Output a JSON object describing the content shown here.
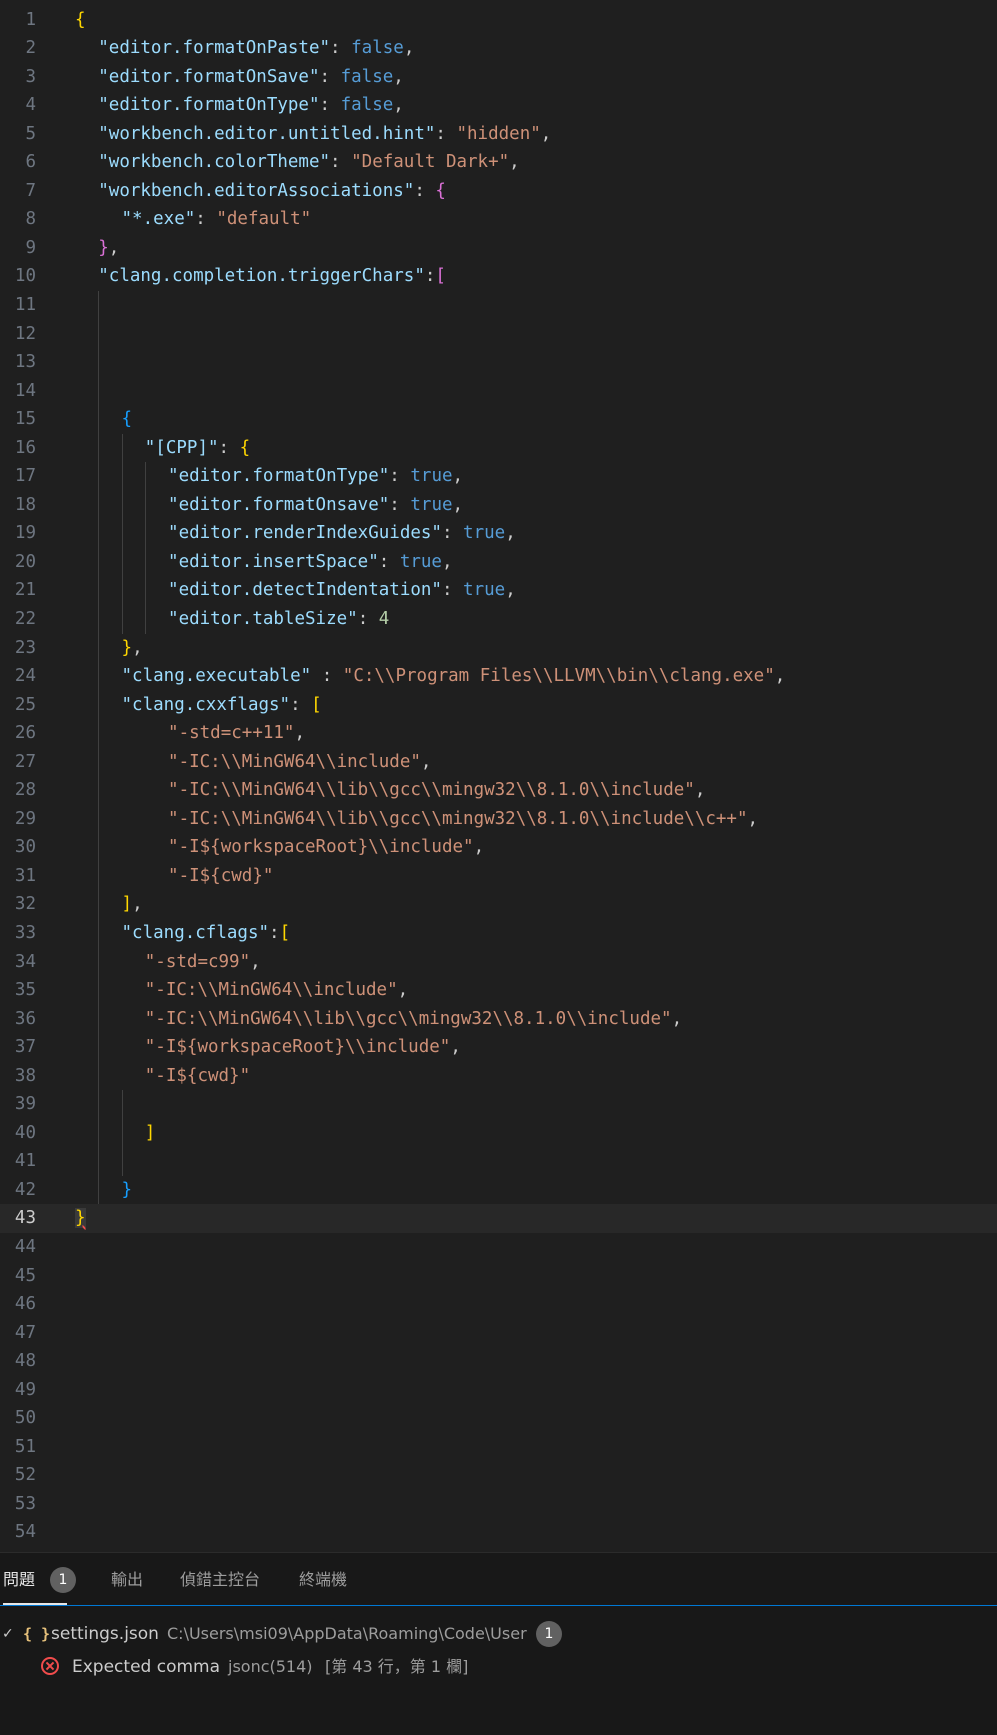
{
  "editor": {
    "current_line": 43,
    "lines": [
      {
        "n": "1",
        "indent": 0,
        "tokens": [
          {
            "t": "{",
            "c": "br1"
          }
        ]
      },
      {
        "n": "2",
        "indent": 1,
        "tokens": [
          {
            "t": "\"editor.formatOnPaste\"",
            "c": "tok-key"
          },
          {
            "t": ": ",
            "c": "tok-punc"
          },
          {
            "t": "false",
            "c": "tok-kw"
          },
          {
            "t": ",",
            "c": "tok-punc"
          }
        ]
      },
      {
        "n": "3",
        "indent": 1,
        "tokens": [
          {
            "t": "\"editor.formatOnSave\"",
            "c": "tok-key"
          },
          {
            "t": ": ",
            "c": "tok-punc"
          },
          {
            "t": "false",
            "c": "tok-kw"
          },
          {
            "t": ",",
            "c": "tok-punc"
          }
        ]
      },
      {
        "n": "4",
        "indent": 1,
        "tokens": [
          {
            "t": "\"editor.formatOnType\"",
            "c": "tok-key"
          },
          {
            "t": ": ",
            "c": "tok-punc"
          },
          {
            "t": "false",
            "c": "tok-kw"
          },
          {
            "t": ",",
            "c": "tok-punc"
          }
        ]
      },
      {
        "n": "5",
        "indent": 1,
        "tokens": [
          {
            "t": "\"workbench.editor.untitled.hint\"",
            "c": "tok-key"
          },
          {
            "t": ": ",
            "c": "tok-punc"
          },
          {
            "t": "\"hidden\"",
            "c": "tok-str"
          },
          {
            "t": ",",
            "c": "tok-punc"
          }
        ]
      },
      {
        "n": "6",
        "indent": 1,
        "tokens": [
          {
            "t": "\"workbench.colorTheme\"",
            "c": "tok-key"
          },
          {
            "t": ": ",
            "c": "tok-punc"
          },
          {
            "t": "\"Default Dark+\"",
            "c": "tok-str"
          },
          {
            "t": ",",
            "c": "tok-punc"
          }
        ]
      },
      {
        "n": "7",
        "indent": 1,
        "tokens": [
          {
            "t": "\"workbench.editorAssociations\"",
            "c": "tok-key"
          },
          {
            "t": ": ",
            "c": "tok-punc"
          },
          {
            "t": "{",
            "c": "br2"
          }
        ]
      },
      {
        "n": "8",
        "indent": 2,
        "tokens": [
          {
            "t": "\"*.exe\"",
            "c": "tok-key"
          },
          {
            "t": ": ",
            "c": "tok-punc"
          },
          {
            "t": "\"default\"",
            "c": "tok-str"
          }
        ]
      },
      {
        "n": "9",
        "indent": 1,
        "tokens": [
          {
            "t": "}",
            "c": "br2"
          },
          {
            "t": ",",
            "c": "tok-punc"
          }
        ]
      },
      {
        "n": "10",
        "indent": 1,
        "tokens": [
          {
            "t": "\"clang.completion.triggerChars\"",
            "c": "tok-key"
          },
          {
            "t": ":",
            "c": "tok-punc"
          },
          {
            "t": "[",
            "c": "br2"
          }
        ]
      },
      {
        "n": "11",
        "indent": 0,
        "guides": [
          1
        ],
        "tokens": []
      },
      {
        "n": "12",
        "indent": 0,
        "guides": [
          1
        ],
        "tokens": []
      },
      {
        "n": "13",
        "indent": 0,
        "guides": [
          1
        ],
        "tokens": []
      },
      {
        "n": "14",
        "indent": 0,
        "guides": [
          1
        ],
        "tokens": []
      },
      {
        "n": "15",
        "indent": 2,
        "guides": [
          1
        ],
        "tokens": [
          {
            "t": "{",
            "c": "br3"
          }
        ]
      },
      {
        "n": "16",
        "indent": 3,
        "guides": [
          1,
          2
        ],
        "tokens": [
          {
            "t": "\"[CPP]\"",
            "c": "tok-key"
          },
          {
            "t": ": ",
            "c": "tok-punc"
          },
          {
            "t": "{",
            "c": "br1"
          }
        ]
      },
      {
        "n": "17",
        "indent": 4,
        "guides": [
          1,
          2,
          3
        ],
        "tokens": [
          {
            "t": "\"editor.formatOnType\"",
            "c": "tok-key"
          },
          {
            "t": ": ",
            "c": "tok-punc"
          },
          {
            "t": "true",
            "c": "tok-kw"
          },
          {
            "t": ",",
            "c": "tok-punc"
          }
        ]
      },
      {
        "n": "18",
        "indent": 4,
        "guides": [
          1,
          2,
          3
        ],
        "tokens": [
          {
            "t": "\"editor.formatOnsave\"",
            "c": "tok-key"
          },
          {
            "t": ": ",
            "c": "tok-punc"
          },
          {
            "t": "true",
            "c": "tok-kw"
          },
          {
            "t": ",",
            "c": "tok-punc"
          }
        ]
      },
      {
        "n": "19",
        "indent": 4,
        "guides": [
          1,
          2,
          3
        ],
        "tokens": [
          {
            "t": "\"editor.renderIndexGuides\"",
            "c": "tok-key"
          },
          {
            "t": ": ",
            "c": "tok-punc"
          },
          {
            "t": "true",
            "c": "tok-kw"
          },
          {
            "t": ",",
            "c": "tok-punc"
          }
        ]
      },
      {
        "n": "20",
        "indent": 4,
        "guides": [
          1,
          2,
          3
        ],
        "tokens": [
          {
            "t": "\"editor.insertSpace\"",
            "c": "tok-key"
          },
          {
            "t": ": ",
            "c": "tok-punc"
          },
          {
            "t": "true",
            "c": "tok-kw"
          },
          {
            "t": ",",
            "c": "tok-punc"
          }
        ]
      },
      {
        "n": "21",
        "indent": 4,
        "guides": [
          1,
          2,
          3
        ],
        "tokens": [
          {
            "t": "\"editor.detectIndentation\"",
            "c": "tok-key"
          },
          {
            "t": ": ",
            "c": "tok-punc"
          },
          {
            "t": "true",
            "c": "tok-kw"
          },
          {
            "t": ",",
            "c": "tok-punc"
          }
        ]
      },
      {
        "n": "22",
        "indent": 4,
        "guides": [
          1,
          2,
          3
        ],
        "tokens": [
          {
            "t": "\"editor.tableSize\"",
            "c": "tok-key"
          },
          {
            "t": ": ",
            "c": "tok-punc"
          },
          {
            "t": "4",
            "c": "tok-num"
          }
        ]
      },
      {
        "n": "23",
        "indent": 2,
        "guides": [
          1
        ],
        "tokens": [
          {
            "t": "}",
            "c": "br1"
          },
          {
            "t": ",",
            "c": "tok-punc"
          }
        ]
      },
      {
        "n": "24",
        "indent": 2,
        "guides": [
          1
        ],
        "tokens": [
          {
            "t": "\"clang.executable\"",
            "c": "tok-key"
          },
          {
            "t": " : ",
            "c": "tok-punc"
          },
          {
            "t": "\"C:\\\\Program Files\\\\LLVM\\\\bin\\\\clang.exe\"",
            "c": "tok-str"
          },
          {
            "t": ",",
            "c": "tok-punc"
          }
        ]
      },
      {
        "n": "25",
        "indent": 2,
        "guides": [
          1
        ],
        "tokens": [
          {
            "t": "\"clang.cxxflags\"",
            "c": "tok-key"
          },
          {
            "t": ": ",
            "c": "tok-punc"
          },
          {
            "t": "[",
            "c": "br1"
          }
        ]
      },
      {
        "n": "26",
        "indent": 4,
        "guides": [
          1
        ],
        "tokens": [
          {
            "t": "\"-std=c++11\"",
            "c": "tok-str"
          },
          {
            "t": ",",
            "c": "tok-punc"
          }
        ]
      },
      {
        "n": "27",
        "indent": 4,
        "guides": [
          1
        ],
        "tokens": [
          {
            "t": "\"-IC:\\\\MinGW64\\\\include\"",
            "c": "tok-str"
          },
          {
            "t": ",",
            "c": "tok-punc"
          }
        ]
      },
      {
        "n": "28",
        "indent": 4,
        "guides": [
          1
        ],
        "tokens": [
          {
            "t": "\"-IC:\\\\MinGW64\\\\lib\\\\gcc\\\\mingw32\\\\8.1.0\\\\include\"",
            "c": "tok-str"
          },
          {
            "t": ",",
            "c": "tok-punc"
          }
        ]
      },
      {
        "n": "29",
        "indent": 4,
        "guides": [
          1
        ],
        "tokens": [
          {
            "t": "\"-IC:\\\\MinGW64\\\\lib\\\\gcc\\\\mingw32\\\\8.1.0\\\\include\\\\c++\"",
            "c": "tok-str"
          },
          {
            "t": ",",
            "c": "tok-punc"
          }
        ]
      },
      {
        "n": "30",
        "indent": 4,
        "guides": [
          1
        ],
        "tokens": [
          {
            "t": "\"-I${workspaceRoot}\\\\include\"",
            "c": "tok-str"
          },
          {
            "t": ",",
            "c": "tok-punc"
          }
        ]
      },
      {
        "n": "31",
        "indent": 4,
        "guides": [
          1
        ],
        "tokens": [
          {
            "t": "\"-I${cwd}\"",
            "c": "tok-str"
          }
        ]
      },
      {
        "n": "32",
        "indent": 2,
        "guides": [
          1
        ],
        "tokens": [
          {
            "t": "]",
            "c": "br1"
          },
          {
            "t": ",",
            "c": "tok-punc"
          }
        ]
      },
      {
        "n": "33",
        "indent": 2,
        "guides": [
          1
        ],
        "tokens": [
          {
            "t": "\"clang.cflags\"",
            "c": "tok-key"
          },
          {
            "t": ":",
            "c": "tok-punc"
          },
          {
            "t": "[",
            "c": "br1"
          }
        ]
      },
      {
        "n": "34",
        "indent": 3,
        "guides": [
          1
        ],
        "tokens": [
          {
            "t": "\"-std=c99\"",
            "c": "tok-str"
          },
          {
            "t": ",",
            "c": "tok-punc"
          }
        ]
      },
      {
        "n": "35",
        "indent": 3,
        "guides": [
          1
        ],
        "tokens": [
          {
            "t": "\"-IC:\\\\MinGW64\\\\include\"",
            "c": "tok-str"
          },
          {
            "t": ",",
            "c": "tok-punc"
          }
        ]
      },
      {
        "n": "36",
        "indent": 3,
        "guides": [
          1
        ],
        "tokens": [
          {
            "t": "\"-IC:\\\\MinGW64\\\\lib\\\\gcc\\\\mingw32\\\\8.1.0\\\\include\"",
            "c": "tok-str"
          },
          {
            "t": ",",
            "c": "tok-punc"
          }
        ]
      },
      {
        "n": "37",
        "indent": 3,
        "guides": [
          1
        ],
        "tokens": [
          {
            "t": "\"-I${workspaceRoot}\\\\include\"",
            "c": "tok-str"
          },
          {
            "t": ",",
            "c": "tok-punc"
          }
        ]
      },
      {
        "n": "38",
        "indent": 3,
        "guides": [
          1
        ],
        "tokens": [
          {
            "t": "\"-I${cwd}\"",
            "c": "tok-str"
          }
        ]
      },
      {
        "n": "39",
        "indent": 0,
        "guides": [
          1,
          2
        ],
        "tokens": []
      },
      {
        "n": "40",
        "indent": 3,
        "guides": [
          1,
          2
        ],
        "tokens": [
          {
            "t": "]",
            "c": "br1"
          }
        ]
      },
      {
        "n": "41",
        "indent": 0,
        "guides": [
          1,
          2
        ],
        "tokens": []
      },
      {
        "n": "42",
        "indent": 2,
        "guides": [
          1
        ],
        "tokens": [
          {
            "t": "}",
            "c": "br3"
          }
        ]
      },
      {
        "n": "43",
        "indent": 0,
        "tokens": [
          {
            "t": "}",
            "c": "err-brace"
          }
        ]
      },
      {
        "n": "44",
        "indent": 0,
        "tokens": []
      },
      {
        "n": "45",
        "indent": 0,
        "tokens": []
      },
      {
        "n": "46",
        "indent": 0,
        "tokens": []
      },
      {
        "n": "47",
        "indent": 0,
        "tokens": []
      },
      {
        "n": "48",
        "indent": 0,
        "tokens": []
      },
      {
        "n": "49",
        "indent": 0,
        "tokens": []
      },
      {
        "n": "50",
        "indent": 0,
        "tokens": []
      },
      {
        "n": "51",
        "indent": 0,
        "tokens": []
      },
      {
        "n": "52",
        "indent": 0,
        "tokens": []
      },
      {
        "n": "53",
        "indent": 0,
        "tokens": []
      },
      {
        "n": "54",
        "indent": 0,
        "tokens": []
      }
    ]
  },
  "panel": {
    "tabs": {
      "problems": "問題",
      "problems_count": "1",
      "output": "輸出",
      "debug_console": "偵錯主控台",
      "terminal": "終端機"
    },
    "file": {
      "chevron": "✓",
      "icon": "{ }",
      "name": "settings.json",
      "path": "C:\\Users\\msi09\\AppData\\Roaming\\Code\\User",
      "count": "1"
    },
    "problem": {
      "message": "Expected comma",
      "source": "jsonc(514)",
      "location": "[第 43 行，第 1 欄]"
    }
  },
  "colors": {
    "background": "#1f1f1f",
    "error": "#f14c4c",
    "focus_border": "#0078d4"
  }
}
